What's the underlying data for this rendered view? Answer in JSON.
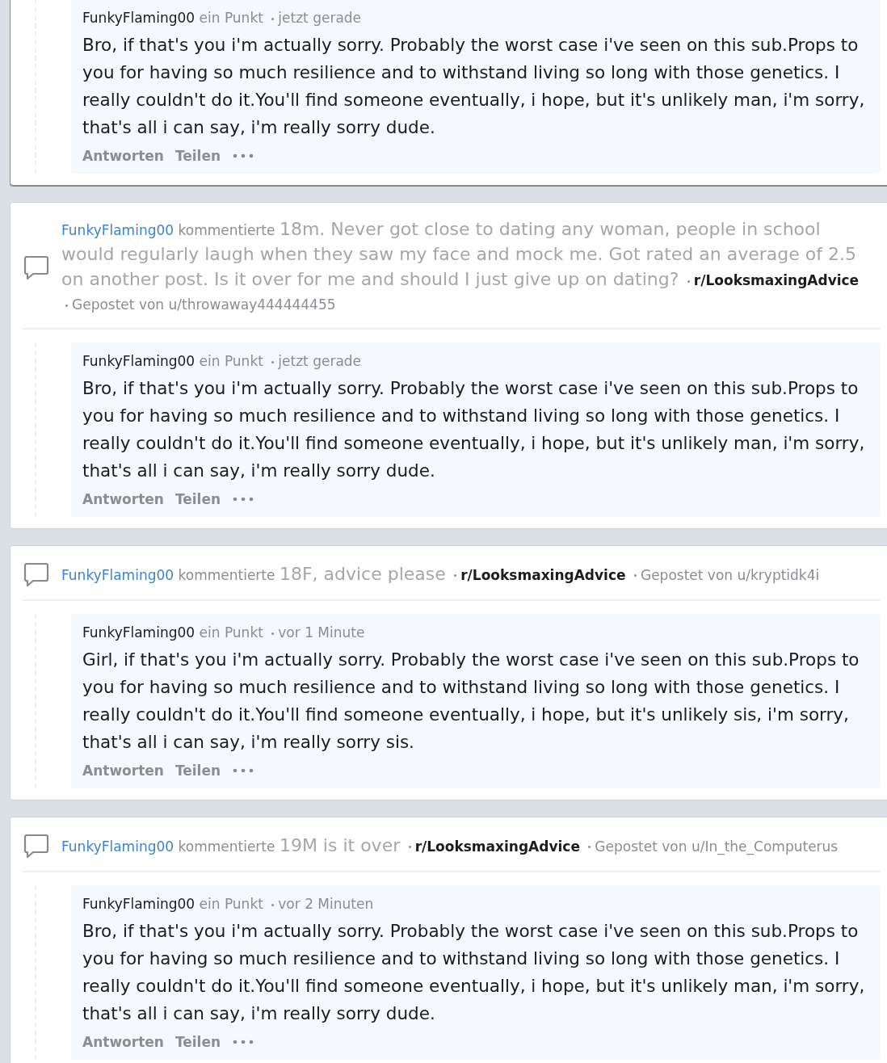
{
  "cards": [
    {
      "highlighted": true,
      "comment": {
        "author": "FunkyFlaming00",
        "points": "ein Punkt",
        "time": "jetzt gerade",
        "body": "Bro, if that's you i'm actually sorry. Probably the worst case i've seen on this sub.Props to you for having so much resilience and to withstand living so long with those genetics. I really couldn't do it.You'll find someone eventually, i hope, but it's unlikely man, i'm sorry, that's all i can say, i'm really sorry dude.",
        "actions": [
          "Antworten",
          "Teilen"
        ]
      }
    },
    {
      "highlighted": false,
      "header": {
        "user": "FunkyFlaming00",
        "verb": "kommentierte",
        "title": "18m. Never got close to dating any woman, people in school would regularly laugh when they saw my face and mock me. Got rated an average of 2.5 on another post. Is it over for me and should I just give up on dating?",
        "subreddit": "r/LooksmaxingAdvice",
        "posted_by": "Gepostet von",
        "op": "u/throwaway444444455"
      },
      "comment": {
        "author": "FunkyFlaming00",
        "points": "ein Punkt",
        "time": "jetzt gerade",
        "body": "Bro, if that's you i'm actually sorry. Probably the worst case i've seen on this sub.Props to you for having so much resilience and to withstand living so long with those genetics. I really couldn't do it.You'll find someone eventually, i hope, but it's unlikely man, i'm sorry, that's all i can say, i'm really sorry dude.",
        "actions": [
          "Antworten",
          "Teilen"
        ]
      }
    },
    {
      "highlighted": false,
      "header": {
        "user": "FunkyFlaming00",
        "verb": "kommentierte",
        "title": "18F, advice please",
        "subreddit": "r/LooksmaxingAdvice",
        "posted_by": "Gepostet von",
        "op": "u/kryptidk4i"
      },
      "comment": {
        "author": "FunkyFlaming00",
        "points": "ein Punkt",
        "time": "vor 1 Minute",
        "body": "Girl, if that's you i'm actually sorry. Probably the worst case i've seen on this sub.Props to you for having so much resilience and to withstand living so long with those genetics. I really couldn't do it.You'll find someone eventually, i hope, but it's unlikely sis, i'm sorry, that's all i can say, i'm really sorry sis.",
        "actions": [
          "Antworten",
          "Teilen"
        ]
      }
    },
    {
      "highlighted": false,
      "header": {
        "user": "FunkyFlaming00",
        "verb": "kommentierte",
        "title": "19M is it over",
        "subreddit": "r/LooksmaxingAdvice",
        "posted_by": "Gepostet von",
        "op": "u/In_the_Computerus"
      },
      "comment": {
        "author": "FunkyFlaming00",
        "points": "ein Punkt",
        "time": "vor 2 Minuten",
        "body": "Bro, if that's you i'm actually sorry. Probably the worst case i've seen on this sub.Props to you for having so much resilience and to withstand living so long with those genetics. I really couldn't do it.You'll find someone eventually, i hope, but it's unlikely man, i'm sorry, that's all i can say, i'm really sorry dude.",
        "actions": [
          "Antworten",
          "Teilen"
        ]
      }
    }
  ]
}
